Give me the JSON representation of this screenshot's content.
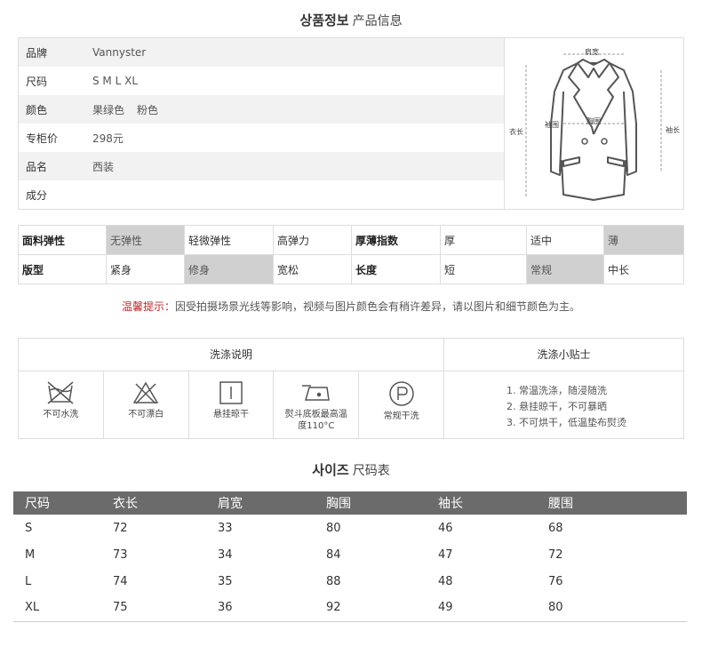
{
  "product_info": {
    "title_kr": "상품정보",
    "title_cn": "产品信息",
    "rows": [
      {
        "label": "品牌",
        "values": [
          "Vannyster"
        ]
      },
      {
        "label": "尺码",
        "values": [
          "S M L XL"
        ]
      },
      {
        "label": "颜色",
        "values": [
          "果绿色",
          "粉色"
        ]
      },
      {
        "label": "专柜价",
        "values": [
          "298元"
        ]
      },
      {
        "label": "品名",
        "values": [
          "西装"
        ]
      },
      {
        "label": "成分",
        "values": [
          ""
        ]
      }
    ],
    "diagram": {
      "shoulder": "肩宽",
      "sleeve_left": "袖围",
      "chest": "胸围",
      "length": "衣长",
      "sleeve": "袖长"
    }
  },
  "attributes": {
    "rows": [
      {
        "label": "面料弹性",
        "options": [
          "无弹性",
          "轻微弹性",
          "高弹力"
        ],
        "selected": 0
      },
      {
        "label": "厚薄指数",
        "options": [
          "厚",
          "适中",
          "薄"
        ],
        "selected": 2
      },
      {
        "label": "版型",
        "options": [
          "紧身",
          "修身",
          "宽松"
        ],
        "selected": 1
      },
      {
        "label": "长度",
        "options": [
          "短",
          "常规",
          "中长"
        ],
        "selected": 1
      }
    ]
  },
  "tip": {
    "label": "温馨提示：",
    "text": "因受拍摄场景光线等影响，视频与图片颜色会有稍许差异，请以图片和细节颜色为主。"
  },
  "washing": {
    "title": "洗涤说明",
    "items": [
      {
        "icon": "no-wash-icon",
        "text": "不可水洗"
      },
      {
        "icon": "no-bleach-icon",
        "text": "不可漂白"
      },
      {
        "icon": "hang-dry-icon",
        "text": "悬挂晾干"
      },
      {
        "icon": "iron-icon",
        "text": "熨斗底板最高温度110°C"
      },
      {
        "icon": "dry-clean-icon",
        "text": "常规干洗"
      }
    ],
    "tips_title": "洗涤小贴士",
    "tips": [
      "1. 常温洗涤，随浸随洗",
      "2. 悬挂晾干，不可暴晒",
      "3. 不可烘干，低温垫布熨烫"
    ]
  },
  "size": {
    "title_kr": "사이즈",
    "title_cn": "尺码表",
    "headers": [
      "尺码",
      "衣长",
      "肩宽",
      "胸围",
      "袖长",
      "腰围"
    ],
    "rows": [
      [
        "S",
        "72",
        "33",
        "80",
        "46",
        "68"
      ],
      [
        "M",
        "73",
        "34",
        "84",
        "47",
        "72"
      ],
      [
        "L",
        "74",
        "35",
        "88",
        "48",
        "76"
      ],
      [
        "XL",
        "75",
        "36",
        "92",
        "49",
        "80"
      ]
    ]
  }
}
